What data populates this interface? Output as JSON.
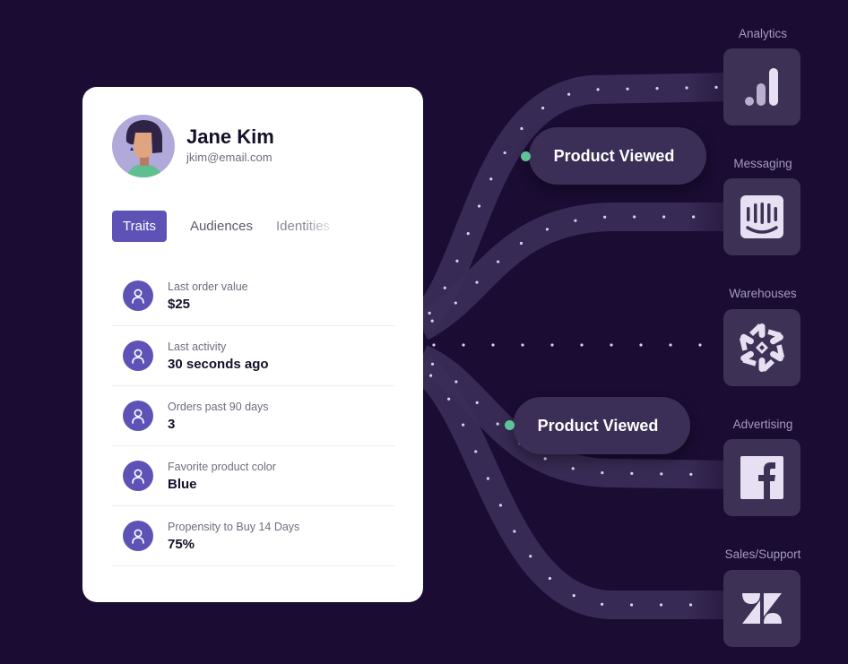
{
  "profile": {
    "name": "Jane Kim",
    "email": "jkim@email.com",
    "avatar": "avatar-illustration"
  },
  "tabs": [
    {
      "label": "Traits",
      "active": true
    },
    {
      "label": "Audiences",
      "active": false
    },
    {
      "label": "Identities",
      "active": false
    }
  ],
  "traits": [
    {
      "label": "Last order value",
      "value": "$25",
      "icon": "user-icon"
    },
    {
      "label": "Last activity",
      "value": "30 seconds ago",
      "icon": "user-icon"
    },
    {
      "label": "Orders past 90 days",
      "value": "3",
      "icon": "user-icon"
    },
    {
      "label": "Favorite product color",
      "value": "Blue",
      "icon": "user-icon"
    },
    {
      "label": "Propensity to Buy 14 Days",
      "value": "75%",
      "icon": "user-icon"
    }
  ],
  "events": [
    {
      "label": "Product Viewed"
    },
    {
      "label": "Product Viewed"
    }
  ],
  "destinations": [
    {
      "label": "Analytics",
      "icon": "google-analytics-icon"
    },
    {
      "label": "Messaging",
      "icon": "intercom-icon"
    },
    {
      "label": "Warehouses",
      "icon": "snowflake-icon"
    },
    {
      "label": "Advertising",
      "icon": "facebook-icon"
    },
    {
      "label": "Sales/Support",
      "icon": "zendesk-icon"
    }
  ],
  "colors": {
    "background": "#1a0c33",
    "accent": "#5f52b7",
    "event_dot": "#5fc495",
    "tile": "#3d3155",
    "flow": "#3a2d57"
  }
}
